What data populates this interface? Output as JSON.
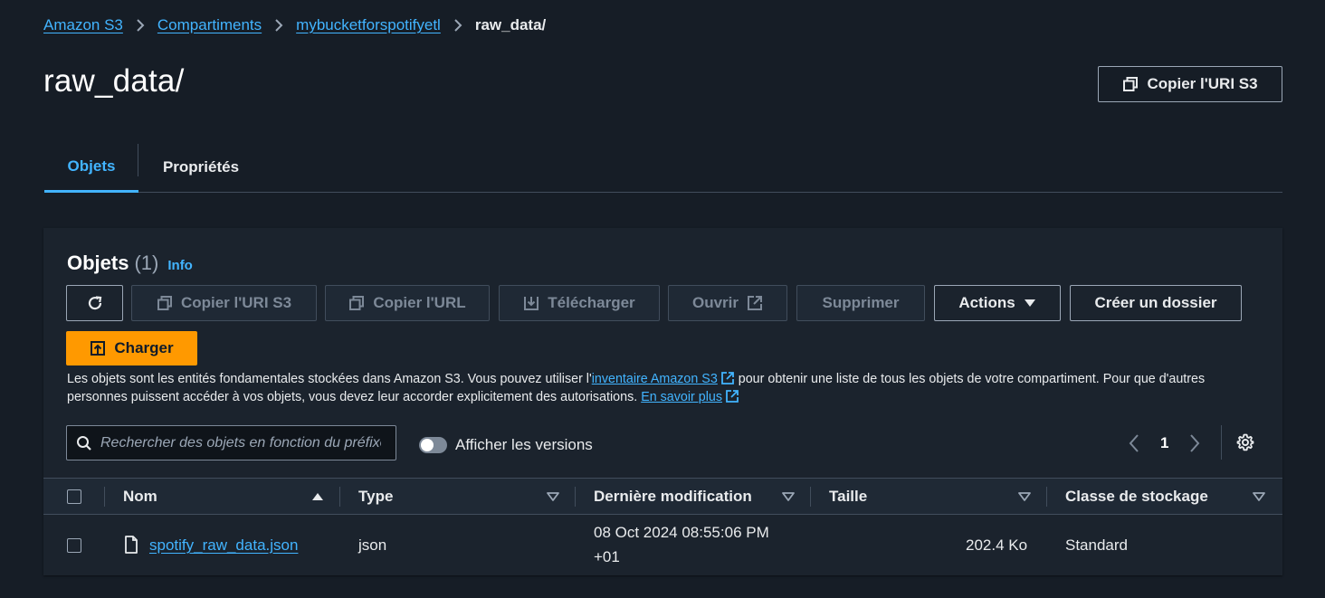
{
  "breadcrumb": {
    "items": [
      "Amazon S3",
      "Compartiments",
      "mybucketforspotifyetl"
    ],
    "current": "raw_data/"
  },
  "page": {
    "title": "raw_data/",
    "copy_uri_label": "Copier l'URI S3"
  },
  "tabs": [
    {
      "label": "Objets",
      "active": true
    },
    {
      "label": "Propriétés",
      "active": false
    }
  ],
  "objects_panel": {
    "title": "Objets",
    "count": "(1)",
    "info_label": "Info",
    "toolbar": {
      "copy_uri": "Copier l'URI S3",
      "copy_url": "Copier l'URL",
      "download": "Télécharger",
      "open": "Ouvrir",
      "delete": "Supprimer",
      "actions": "Actions",
      "create_folder": "Créer un dossier",
      "upload": "Charger"
    },
    "description": {
      "part1": "Les objets sont les entités fondamentales stockées dans Amazon S3. Vous pouvez utiliser l'",
      "link1": "inventaire Amazon S3",
      "part2": " pour obtenir une liste de tous les objets de votre compartiment. Pour que d'autres personnes puissent accéder à vos objets, vous devez leur accorder explicitement des autorisations. ",
      "link2": "En savoir plus"
    },
    "search_placeholder": "Rechercher des objets en fonction du préfixe",
    "show_versions_label": "Afficher les versions",
    "show_versions": false,
    "page_number": "1",
    "columns": [
      "Nom",
      "Type",
      "Dernière modification",
      "Taille",
      "Classe de stockage"
    ],
    "rows": [
      {
        "name": "spotify_raw_data.json",
        "type": "json",
        "modified_line1": "08 Oct 2024 08:55:06 PM",
        "modified_line2": "+01",
        "size": "202.4 Ko",
        "storage_class": "Standard"
      }
    ]
  },
  "colors": {
    "background": "#161d26",
    "panel": "#1b232d",
    "link": "#42b4ff",
    "primary": "#ff9900"
  }
}
